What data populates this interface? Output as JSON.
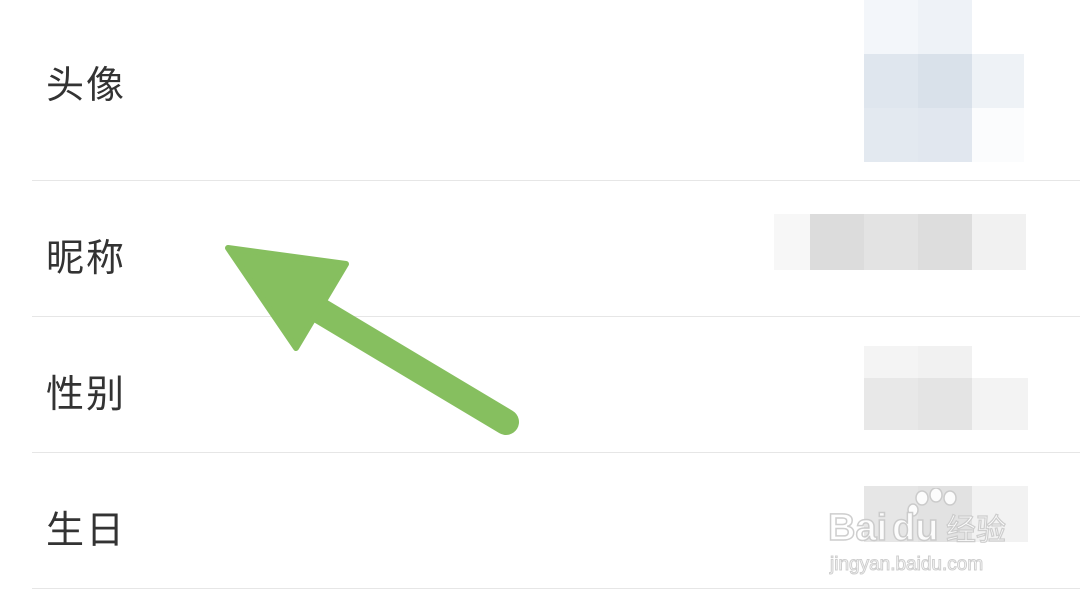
{
  "profile_rows": [
    {
      "label": "头像",
      "value_hidden": true
    },
    {
      "label": "昵称",
      "value_hidden": true
    },
    {
      "label": "性别",
      "value_hidden": true
    },
    {
      "label": "生日",
      "value_hidden": true
    }
  ],
  "annotation": {
    "type": "arrow",
    "color": "#86bf5f",
    "points_to": "昵称"
  },
  "watermark": {
    "text": "Baidu经验",
    "subtext": "jingyan.baidu.com"
  }
}
